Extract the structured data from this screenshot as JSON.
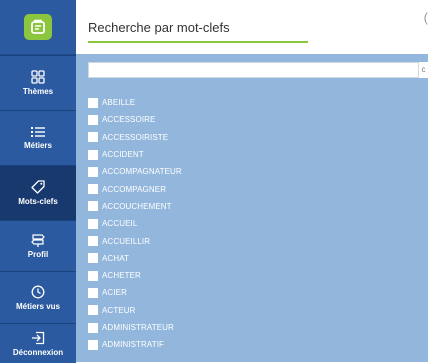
{
  "sidebar": {
    "items": [
      {
        "label": "Thèmes",
        "icon": "grid-icon",
        "active": false
      },
      {
        "label": "Métiers",
        "icon": "list-icon",
        "active": false
      },
      {
        "label": "Mots-clefs",
        "icon": "tag-icon",
        "active": true
      },
      {
        "label": "Profil",
        "icon": "signpost-icon",
        "active": false
      },
      {
        "label": "Métiers vus",
        "icon": "clock-icon",
        "active": false
      },
      {
        "label": "Déconnexion",
        "icon": "logout-icon",
        "active": false
      }
    ]
  },
  "header": {
    "title": "Recherche par mot-clefs",
    "edge_glyph": "("
  },
  "search": {
    "value": "",
    "placeholder": "",
    "edge_char": "c"
  },
  "keywords": [
    "ABEILLE",
    "ACCESSOIRE",
    "ACCESSOIRISTE",
    "ACCIDENT",
    "ACCOMPAGNATEUR",
    "ACCOMPAGNER",
    "ACCOUCHEMENT",
    "ACCUEIL",
    "ACCUEILLIR",
    "ACHAT",
    "ACHETER",
    "ACIER",
    "ACTEUR",
    "ADMINISTRATEUR",
    "ADMINISTRATIF"
  ],
  "colors": {
    "sidebar": "#2b5aa0",
    "sidebar_active": "#17396e",
    "accent": "#8cc63f",
    "content_bg": "#93b7dc"
  }
}
